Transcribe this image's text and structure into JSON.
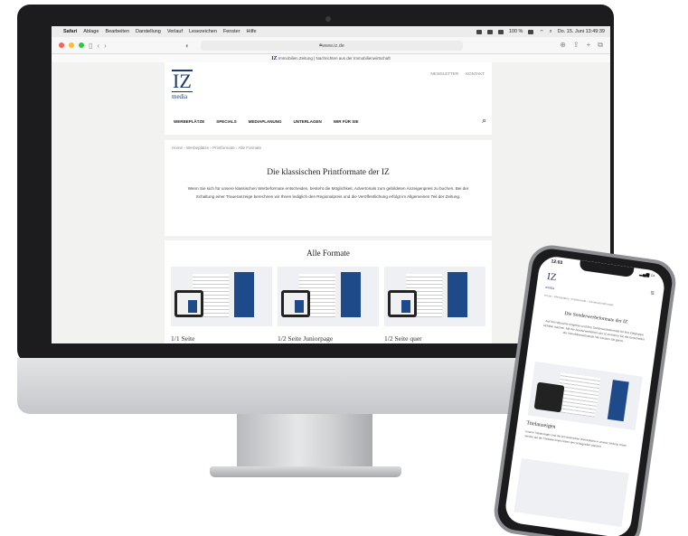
{
  "macos_menubar": {
    "items": [
      "Safari",
      "Ablage",
      "Bearbeiten",
      "Darstellung",
      "Verlauf",
      "Lesezeichen",
      "Fenster",
      "Hilfe"
    ],
    "battery": "100 %",
    "clock": "Do. 15. Juni 13:49:39"
  },
  "browser": {
    "url": "www.iz.de",
    "banner": "Immobilien Zeitung | Nachrichten aus der Immobilienwirtschaft",
    "banner_logo": "IZ"
  },
  "site": {
    "logo_main": "IZ",
    "logo_sub": "media",
    "top_links": [
      "NEWSLETTER",
      "KONTAKT"
    ],
    "nav": [
      "WERBEPLÄTZE",
      "SPECIALS",
      "MEDIAPLANUNG",
      "UNTERLAGEN",
      "WIR FÜR SIE"
    ],
    "breadcrumb": "Home  ›  Werbeplätze  ›  Printformate  ›  Alle Formate",
    "hero_title": "Die klassischen Printformate der IZ",
    "hero_text": "Wenn Sie sich für unsere klassischen Werbeformate entscheiden, besteht die Möglichkeit, Advertorials zum gebildeten Anzeigenpreis zu buchen. Bei der Schaltung einer Traueranzeige berechnen wir Ihnen lediglich den Regionalpreis und die Veröffentlichung erfolgt im Allgemeinen Teil der Zeitung.",
    "formats_title": "Alle Formate",
    "formats": [
      {
        "label": "1/1 Seite"
      },
      {
        "label": "1/2 Seite Juniorpage"
      },
      {
        "label": "1/2 Seite quer"
      }
    ]
  },
  "phone": {
    "time": "12:03",
    "logo_main": "IZ",
    "logo_sub": "media",
    "breadcrumb": "Home › Werbeplätze › Printformate › Sonderwerbeformate",
    "title": "Die Sonderwerbeformate der IZ",
    "text": "Auf Ihre Wünsche eingehen und Ihre Sonderwerbeformate für Ihre Zielgruppe sichtbar machen. Mit der Sonderwerbeform der IZ erreichen Sie die Entscheider der Immobilienwirtschaft. Wir beraten Sie gerne.",
    "section_title": "Titelanzeigen",
    "section_text": "Unsere Titelanzeigen sind die prominentesten Werbeplätze in unserer Zeitung. Diese werden auf der Titelseite direkt neben den Schlagzeilen platziert."
  },
  "colors": {
    "brand_blue": "#1b3a6b",
    "accent_blue": "#1f4a8a",
    "traffic_red": "#ff5f57",
    "traffic_yellow": "#febc2e",
    "traffic_green": "#28c840"
  }
}
